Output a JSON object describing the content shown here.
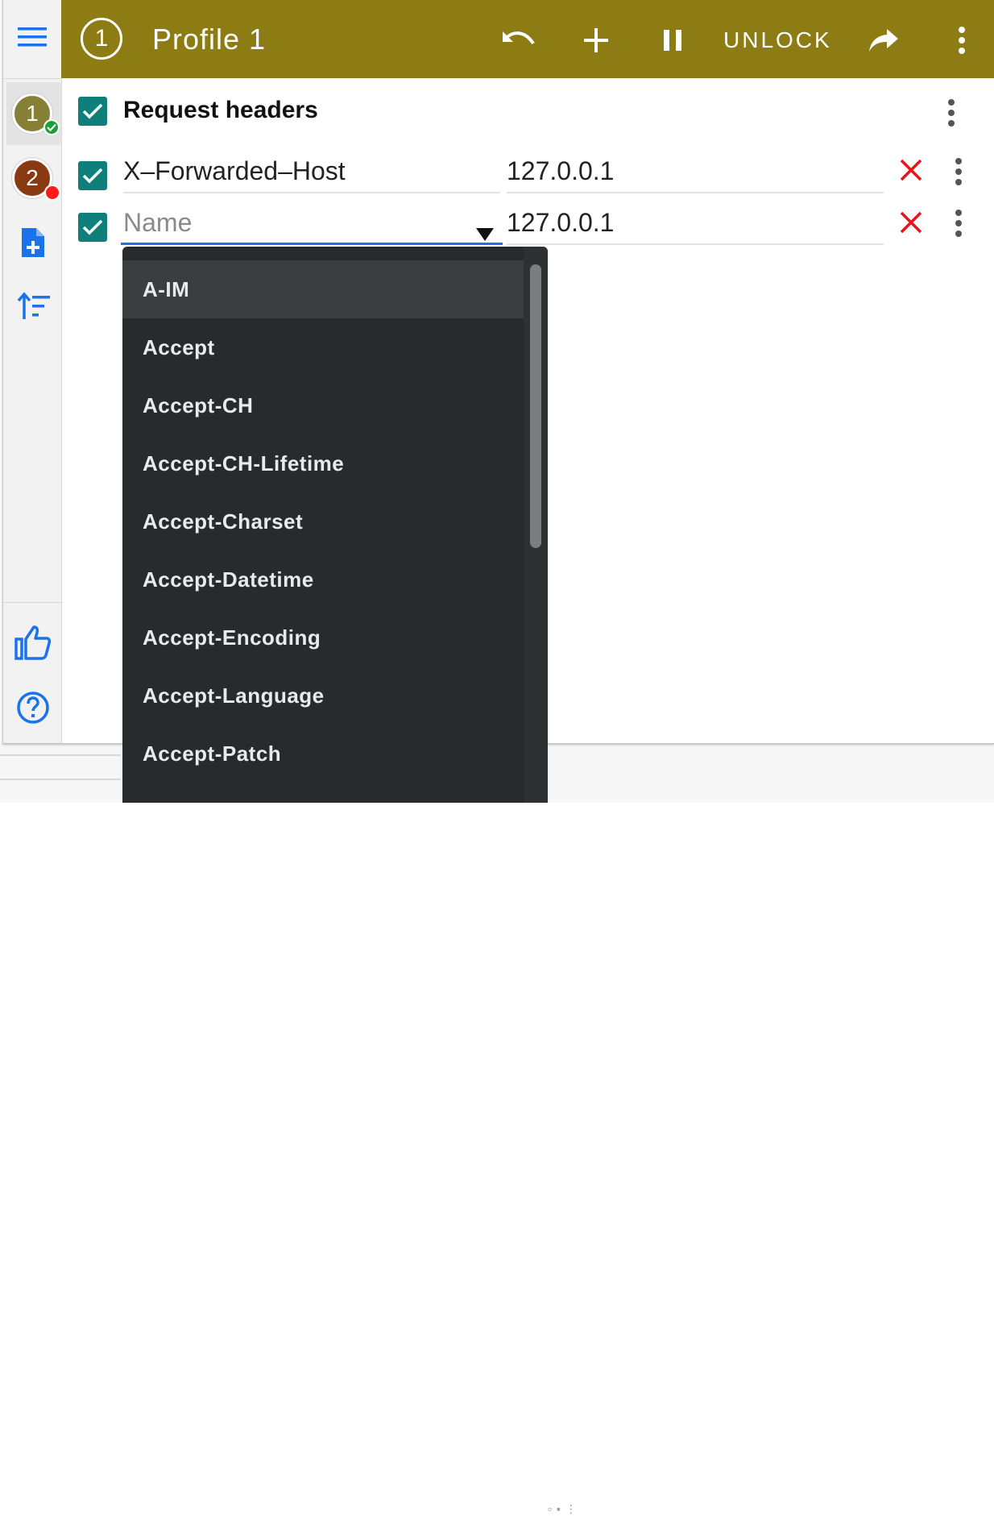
{
  "header": {
    "profile_number": "1",
    "title": "Profile 1",
    "unlock_label": "UNLOCK",
    "accent_color": "#8c7c13"
  },
  "sidebar": {
    "profiles": [
      {
        "number": "1",
        "color": "#858035",
        "status": "enabled",
        "status_color": "#1e9e3a"
      },
      {
        "number": "2",
        "color": "#8a3a12",
        "status": "paused",
        "status_color": "#ff1a1a"
      }
    ],
    "icons": [
      "menu-icon",
      "add-profile-icon",
      "sort-icon",
      "thumbs-up-icon",
      "help-icon"
    ]
  },
  "section": {
    "title": "Request headers",
    "enabled": true
  },
  "rows": [
    {
      "enabled": true,
      "name": "X–Forwarded–Host",
      "value": "127.0.0.1"
    },
    {
      "enabled": true,
      "name": "",
      "name_placeholder": "Name",
      "value": "127.0.0.1"
    }
  ],
  "autocomplete": {
    "options": [
      "A-IM",
      "Accept",
      "Accept-CH",
      "Accept-CH-Lifetime",
      "Accept-Charset",
      "Accept-Datetime",
      "Accept-Encoding",
      "Accept-Language",
      "Accept-Patch"
    ],
    "highlighted": "A-IM"
  }
}
